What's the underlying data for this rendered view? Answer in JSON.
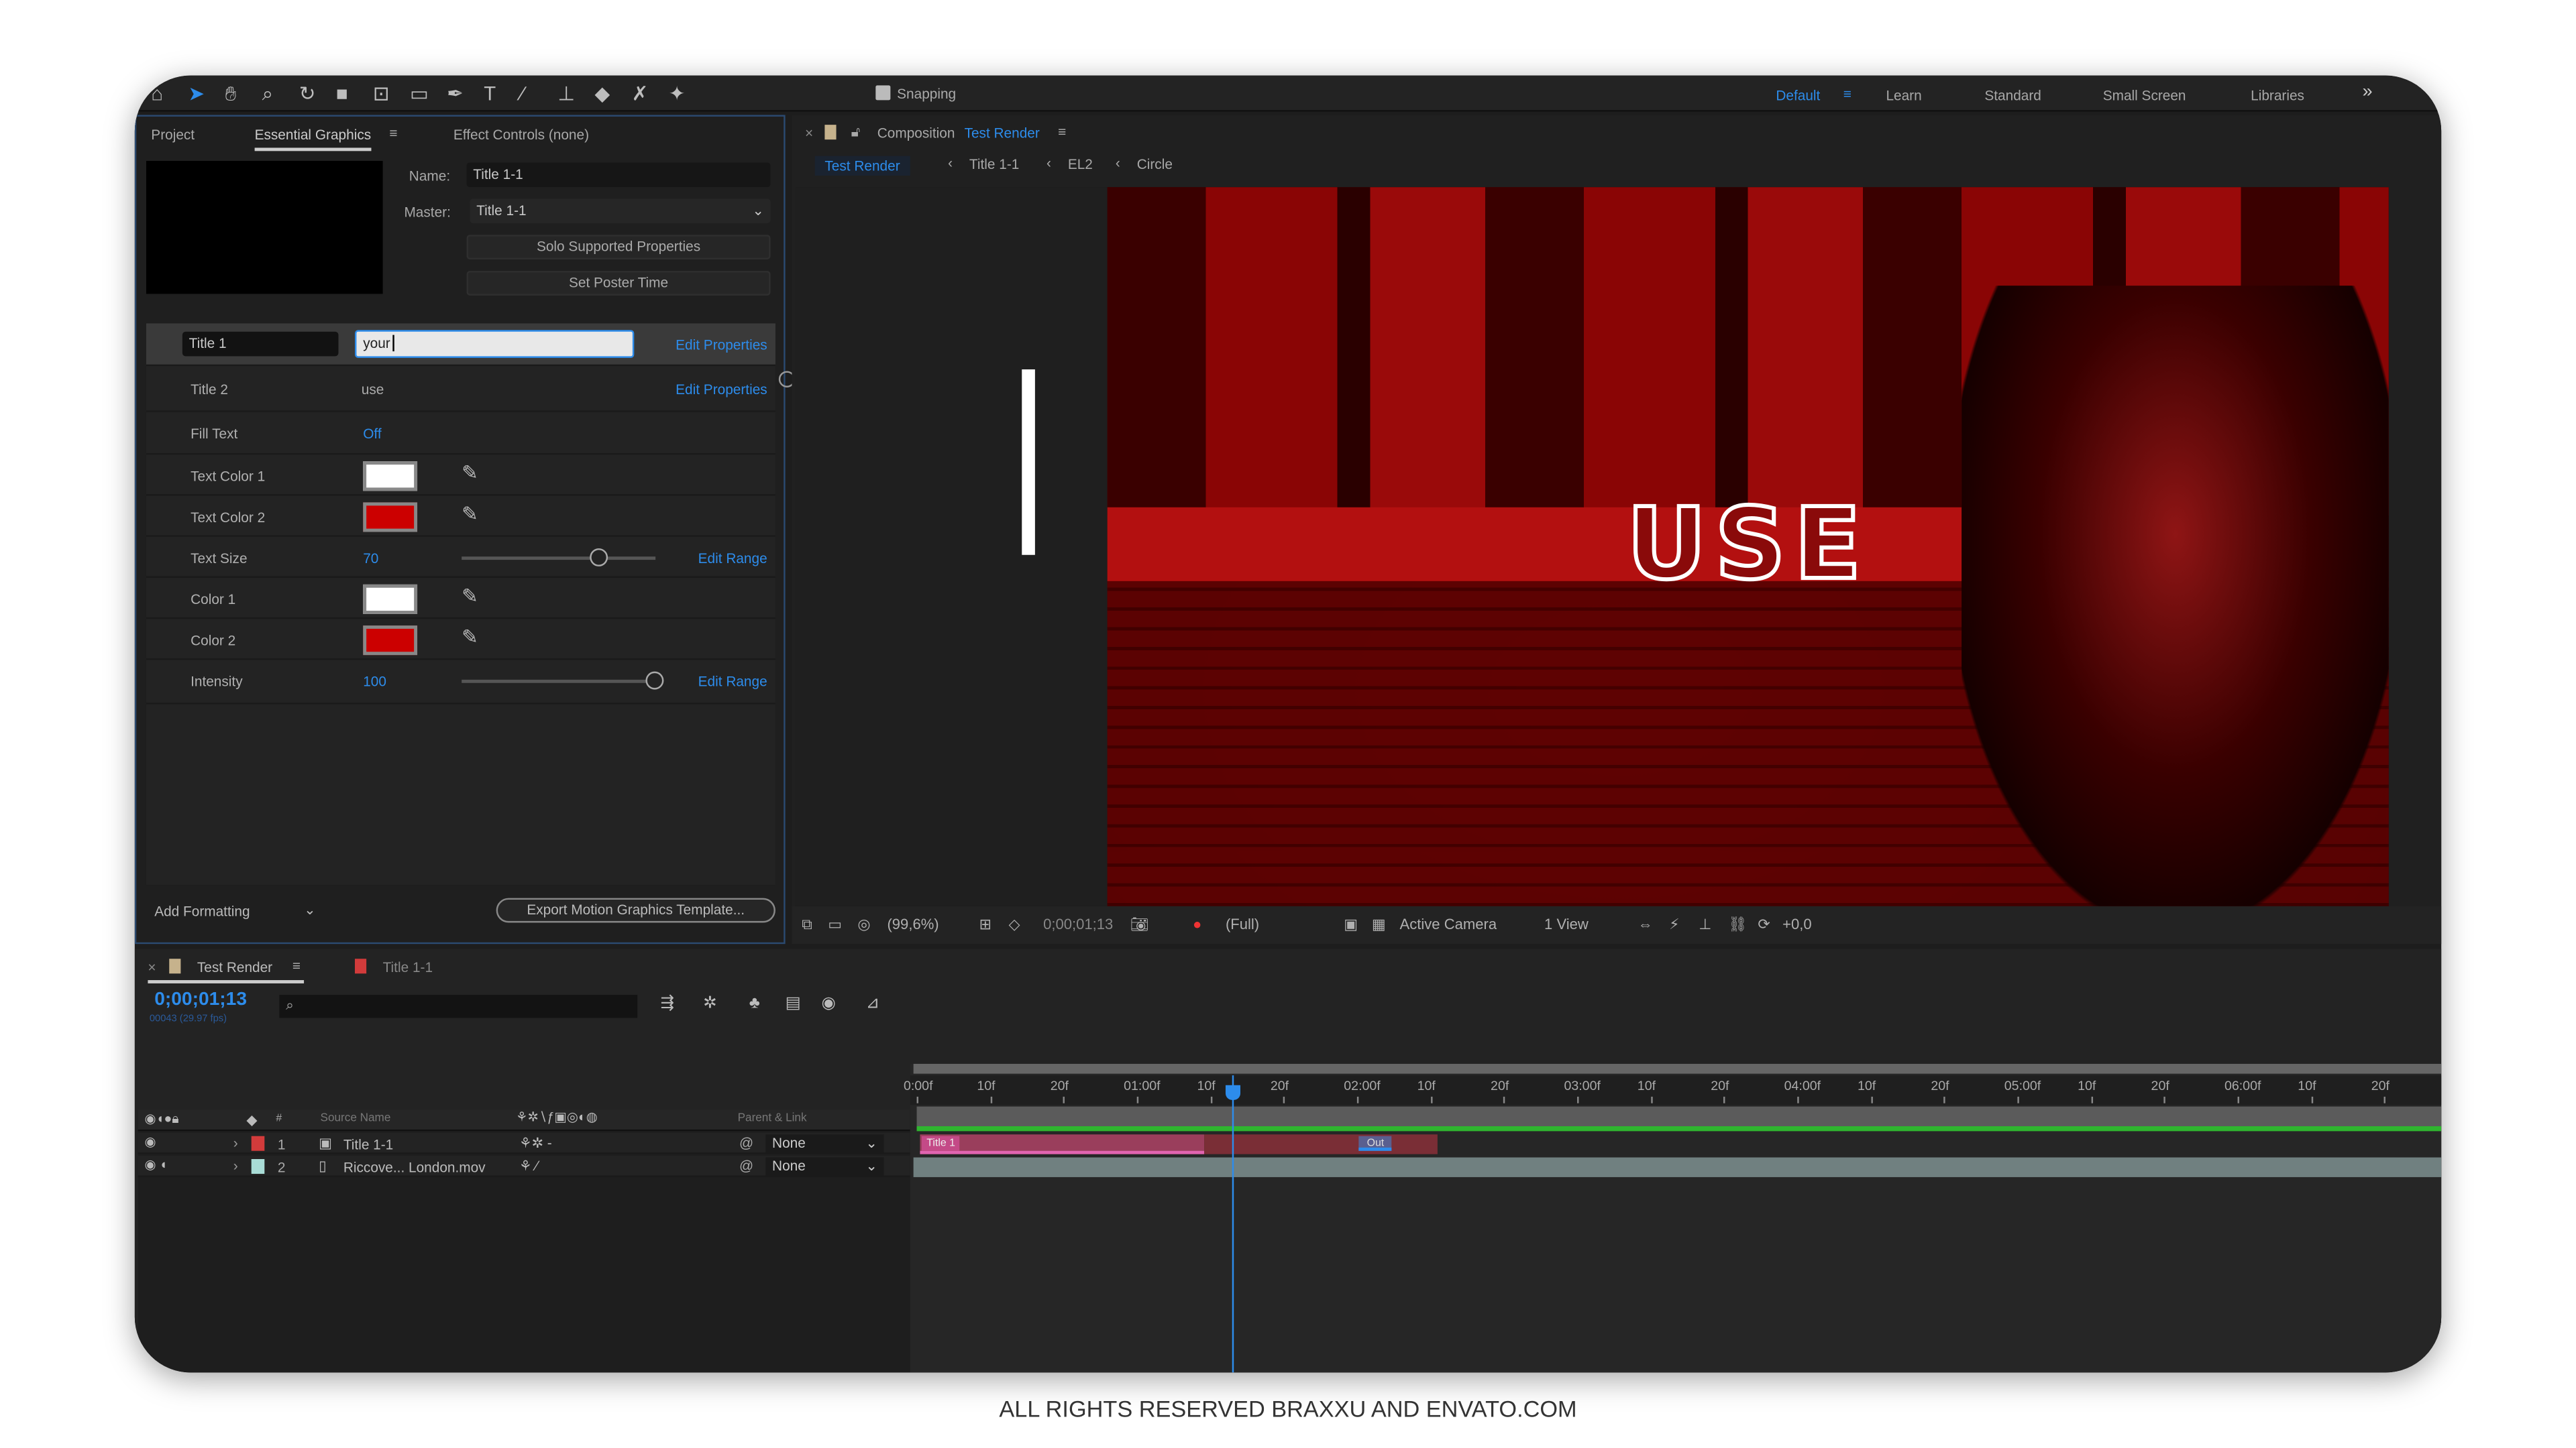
{
  "toolbar": {
    "icons": [
      "home-icon",
      "selection-icon",
      "hand-icon",
      "zoom-icon",
      "rotate-icon",
      "camera-icon",
      "pan-behind-icon",
      "rectangle-icon",
      "pen-icon",
      "text-icon",
      "brush-icon",
      "clone-stamp-icon",
      "eraser-icon",
      "roto-brush-icon",
      "puppet-pin-icon"
    ],
    "snapping_label": "Snapping",
    "snapping_checked": true
  },
  "workspaces": {
    "items": [
      "Default",
      "Learn",
      "Standard",
      "Small Screen",
      "Libraries"
    ],
    "active": "Default"
  },
  "left_panel": {
    "tabs": [
      "Project",
      "Essential Graphics",
      "Effect Controls (none)"
    ],
    "active_tab": "Essential Graphics",
    "name_label": "Name:",
    "name_value": "Title 1-1",
    "master_label": "Master:",
    "master_value": "Title 1-1",
    "solo_button": "Solo Supported Properties",
    "poster_button": "Set Poster Time",
    "title1": {
      "label": "Title 1",
      "value": "your",
      "edit": "Edit Properties"
    },
    "title2": {
      "label": "Title 2",
      "value": "use",
      "edit": "Edit Properties"
    },
    "fill_text": {
      "label": "Fill Text",
      "value": "Off"
    },
    "text_color1": {
      "label": "Text Color 1",
      "color": "#ffffff"
    },
    "text_color2": {
      "label": "Text Color 2",
      "color": "#cc0000"
    },
    "text_size": {
      "label": "Text Size",
      "value": "70",
      "slider_fraction": 0.7,
      "edit": "Edit Range"
    },
    "color1": {
      "label": "Color 1",
      "color": "#ffffff"
    },
    "color2": {
      "label": "Color 2",
      "color": "#cc0000"
    },
    "intensity": {
      "label": "Intensity",
      "value": "100",
      "slider_fraction": 1.0,
      "edit": "Edit Range"
    },
    "add_formatting": "Add Formatting",
    "export_button": "Export Motion Graphics Template..."
  },
  "composition": {
    "tab_prefix": "Composition",
    "tab_name": "Test Render",
    "breadcrumbs": [
      "Test Render",
      "Title 1-1",
      "EL2",
      "Circle"
    ],
    "overlay_text": "USE",
    "viewer_toolbar": {
      "zoom": "(99,6%)",
      "timecode": "0;00;01;13",
      "resolution": "(Full)",
      "camera": "Active Camera",
      "views": "1 View",
      "exposure": "+0,0"
    }
  },
  "timeline": {
    "tabs": [
      "Test Render",
      "Title 1-1"
    ],
    "timecode": "0;00;01;13",
    "frame_info": "00043 (29.97 fps)",
    "columns": {
      "source_name": "Source Name",
      "number": "#",
      "parent": "Parent & Link"
    },
    "layers": [
      {
        "num": "1",
        "name": "Title 1-1",
        "label_color": "#d23b3b",
        "parent": "None"
      },
      {
        "num": "2",
        "name": "Riccove... London.mov",
        "label_color": "#a9dcd6",
        "parent": "None"
      }
    ],
    "ruler": [
      "0:00f",
      "10f",
      "20f",
      "01:00f",
      "10f",
      "20f",
      "02:00f",
      "10f",
      "20f",
      "03:00f",
      "10f",
      "20f",
      "04:00f",
      "10f",
      "20f",
      "05:00f",
      "10f",
      "20f",
      "06:00f",
      "10f",
      "20f"
    ],
    "current_frame": 43,
    "markers": {
      "in": "Title 1",
      "out": "Out"
    }
  },
  "footer": "ALL RIGHTS RESERVED BRAXXU AND ENVATO.COM"
}
